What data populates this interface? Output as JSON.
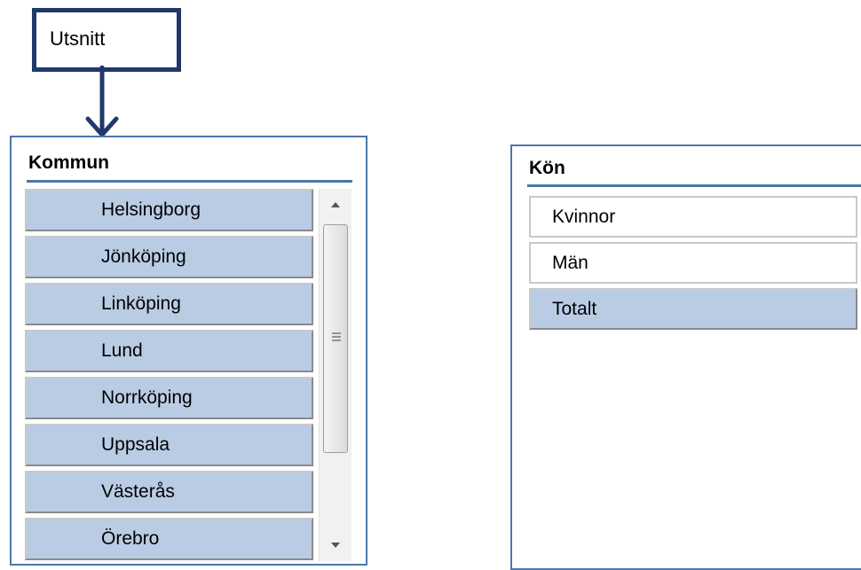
{
  "callout": {
    "label": "Utsnitt"
  },
  "kommun": {
    "title": "Kommun",
    "items": [
      {
        "label": "Helsingborg"
      },
      {
        "label": "Jönköping"
      },
      {
        "label": "Linköping"
      },
      {
        "label": "Lund"
      },
      {
        "label": "Norrköping"
      },
      {
        "label": "Uppsala"
      },
      {
        "label": "Västerås"
      },
      {
        "label": "Örebro"
      }
    ]
  },
  "kon": {
    "title": "Kön",
    "items": [
      {
        "label": "Kvinnor",
        "selected": false
      },
      {
        "label": "Män",
        "selected": false
      },
      {
        "label": "Totalt",
        "selected": true
      }
    ]
  },
  "colors": {
    "selected_fill": "#b9cce4",
    "panel_border": "#4a77aa",
    "callout_border": "#20386a"
  },
  "icons": {
    "scroll_up": "triangle-up-icon",
    "scroll_down": "triangle-down-icon",
    "thumb_grip": "grip-lines-icon",
    "callout_arrow": "arrow-down-icon"
  }
}
